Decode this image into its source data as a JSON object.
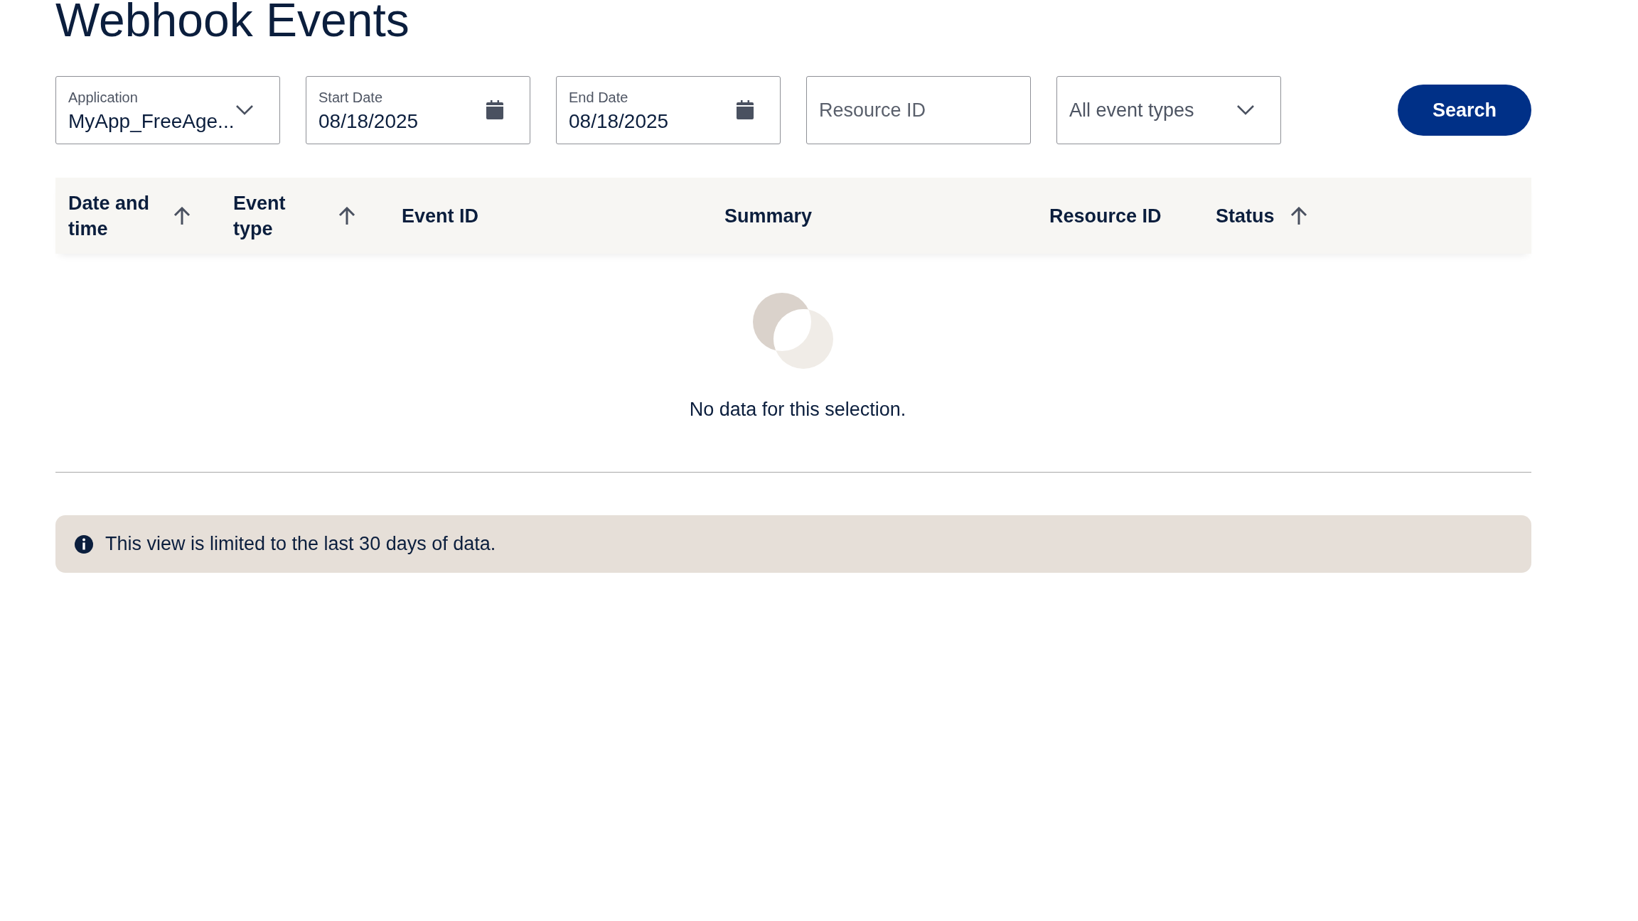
{
  "page": {
    "title": "Webhook Events"
  },
  "filters": [
    {
      "kind": "select",
      "label": "Application",
      "value": "MyApp_FreeAge..."
    },
    {
      "kind": "date",
      "label": "Start Date",
      "value": "08/18/2025"
    },
    {
      "kind": "date",
      "label": "End Date",
      "value": "08/18/2025"
    },
    {
      "kind": "text",
      "placeholder": "Resource ID"
    },
    {
      "kind": "dropdown",
      "value": "All event types"
    }
  ],
  "search_button": "Search",
  "table": {
    "columns": [
      {
        "label": "Date and time",
        "sortable": true
      },
      {
        "label": "Event type",
        "sortable": true
      },
      {
        "label": "Event ID",
        "sortable": false
      },
      {
        "label": "Summary",
        "sortable": false
      },
      {
        "label": "Resource ID",
        "sortable": false
      },
      {
        "label": "Status",
        "sortable": true
      }
    ],
    "empty_message": "No data for this selection."
  },
  "notice": "This view is limited to the last 30 days of data."
}
